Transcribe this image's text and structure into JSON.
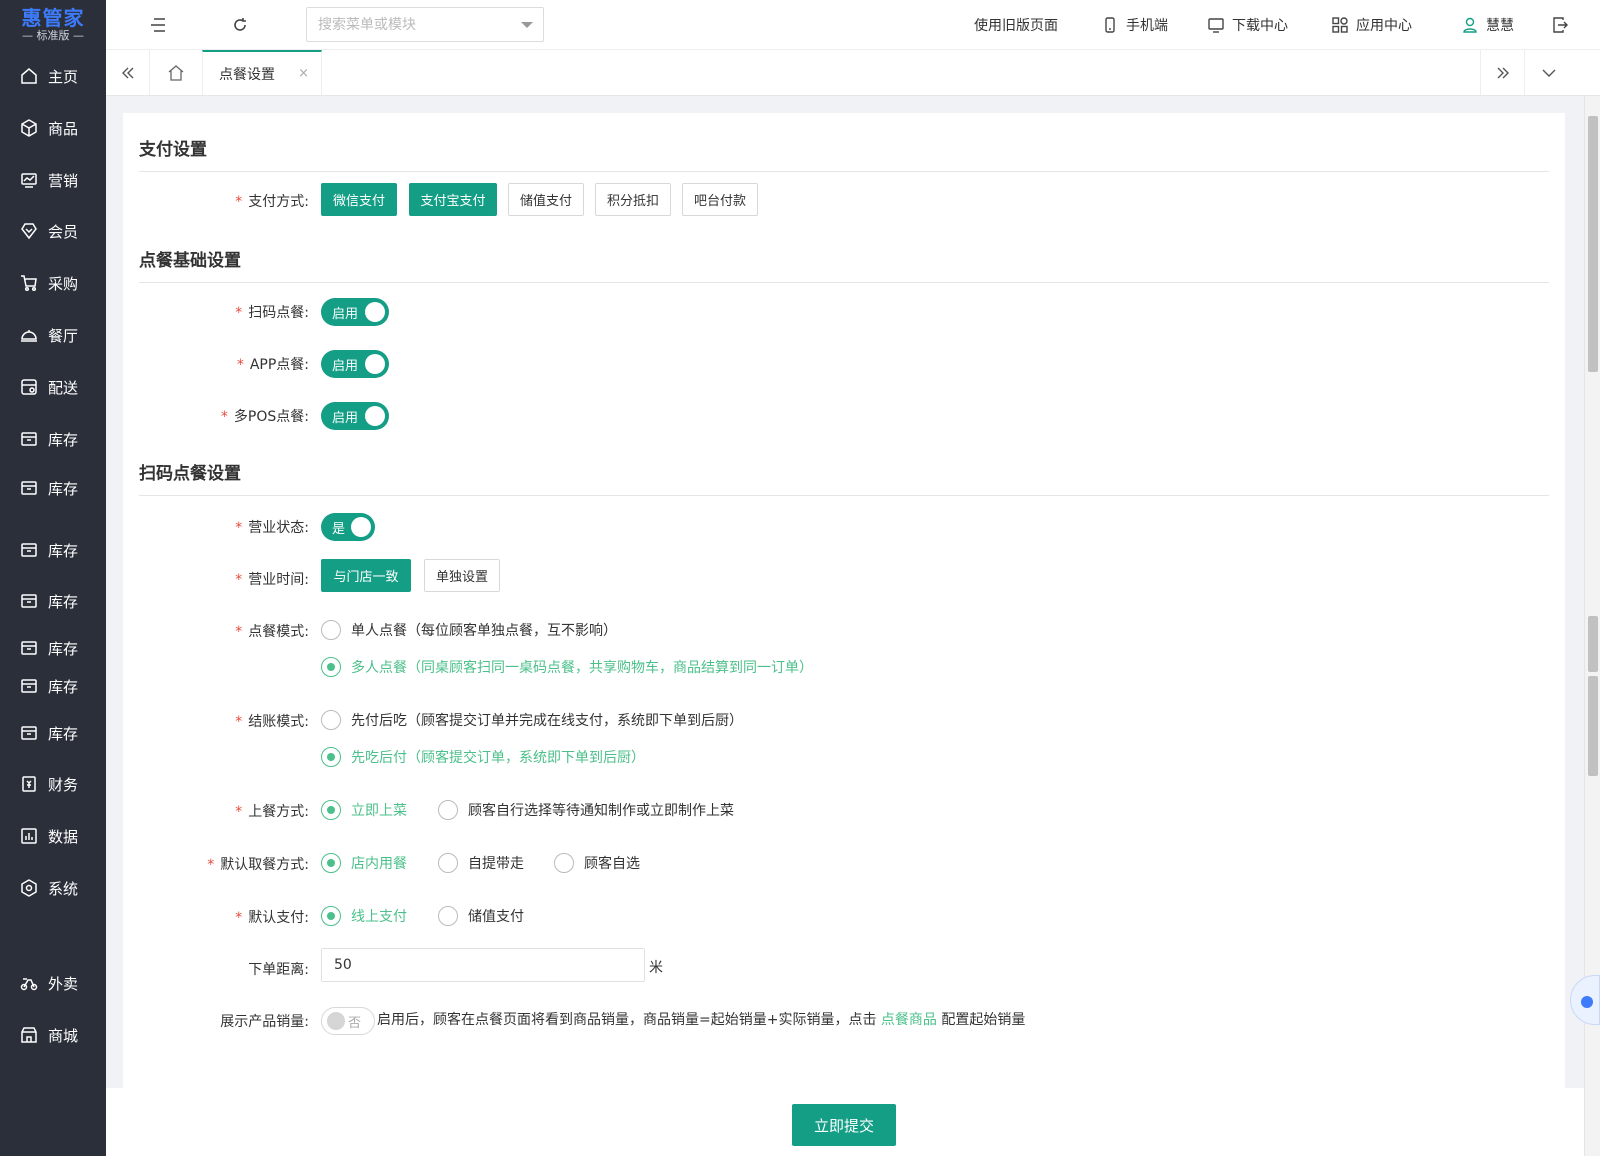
{
  "app": {
    "logo_main": "惠管家",
    "logo_sub": "— 标准版 —"
  },
  "sidebar": {
    "items": [
      {
        "label": "主页",
        "icon": "home-icon"
      },
      {
        "label": "商品",
        "icon": "box-icon"
      },
      {
        "label": "营销",
        "icon": "chart-icon"
      },
      {
        "label": "会员",
        "icon": "diamond-icon"
      },
      {
        "label": "采购",
        "icon": "cart-icon"
      },
      {
        "label": "餐厅",
        "icon": "cloche-icon"
      },
      {
        "label": "配送",
        "icon": "delivery-icon"
      },
      {
        "label": "库存",
        "icon": "inventory-icon"
      },
      {
        "label": "库存",
        "icon": "inventory-icon"
      },
      {
        "label": "库存",
        "icon": "inventory-icon"
      },
      {
        "label": "库存",
        "icon": "inventory-icon"
      },
      {
        "label": "库存",
        "icon": "inventory-icon"
      },
      {
        "label": "库存",
        "icon": "inventory-icon"
      },
      {
        "label": "库存",
        "icon": "inventory-icon"
      },
      {
        "label": "财务",
        "icon": "finance-icon"
      },
      {
        "label": "数据",
        "icon": "data-icon"
      },
      {
        "label": "系统",
        "icon": "settings-icon"
      },
      {
        "label": "外卖",
        "icon": "scooter-icon"
      },
      {
        "label": "商城",
        "icon": "store-icon"
      }
    ]
  },
  "header": {
    "search_placeholder": "搜索菜单或模块",
    "old_version": "使用旧版页面",
    "mobile": "手机端",
    "download": "下载中心",
    "app_center": "应用中心",
    "user": "慧慧"
  },
  "tabs": {
    "active": "点餐设置",
    "close": "×"
  },
  "sections": {
    "payment": "支付设置",
    "basic": "点餐基础设置",
    "scan": "扫码点餐设置"
  },
  "payment": {
    "label": "支付方式:",
    "options": [
      {
        "label": "微信支付",
        "selected": true
      },
      {
        "label": "支付宝支付",
        "selected": true
      },
      {
        "label": "储值支付",
        "selected": false
      },
      {
        "label": "积分抵扣",
        "selected": false
      },
      {
        "label": "吧台付款",
        "selected": false
      }
    ]
  },
  "basic": {
    "scan_label": "扫码点餐:",
    "app_label": "APP点餐:",
    "pos_label": "多POS点餐:",
    "switch_on": "启用"
  },
  "scan": {
    "status_label": "营业状态:",
    "status_value": "是",
    "hours_label": "营业时间:",
    "hours_same": "与门店一致",
    "hours_custom": "单独设置",
    "mode_label": "点餐模式:",
    "mode_single": "单人点餐（每位顾客单独点餐，互不影响）",
    "mode_multi": "多人点餐（同桌顾客扫同一桌码点餐，共享购物车，商品结算到同一订单）",
    "checkout_label": "结账模式:",
    "checkout_prepay": "先付后吃（顾客提交订单并完成在线支付，系统即下单到后厨）",
    "checkout_postpay": "先吃后付（顾客提交订单，系统即下单到后厨）",
    "serve_label": "上餐方式:",
    "serve_now": "立即上菜",
    "serve_choose": "顾客自行选择等待通知制作或立即制作上菜",
    "pickup_label": "默认取餐方式:",
    "pickup_dine": "店内用餐",
    "pickup_self": "自提带走",
    "pickup_choose": "顾客自选",
    "pay_label": "默认支付:",
    "pay_online": "线上支付",
    "pay_stored": "储值支付",
    "distance_label": "下单距离:",
    "distance_value": "50",
    "distance_unit": "米",
    "sales_label": "展示产品销量:",
    "sales_switch": "否",
    "sales_note_pre": "启用后，顾客在点餐页面将看到商品销量，商品销量=起始销量+实际销量，点击 ",
    "sales_note_link": "点餐商品",
    "sales_note_post": " 配置起始销量"
  },
  "footer": {
    "submit": "立即提交"
  },
  "colors": {
    "primary": "#139e85",
    "radio_checked": "#4cc08a",
    "required": "#e94b3c",
    "sidebar_bg": "#2b2f3a",
    "logo": "#3d7bfa"
  }
}
